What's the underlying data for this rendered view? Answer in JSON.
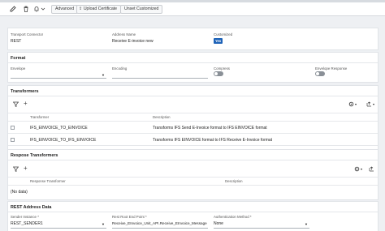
{
  "toolbar": {
    "advanced_label": "Advanced",
    "upload_label": "Upload Certificate",
    "unset_label": "Unset Customized"
  },
  "header": {
    "transport_connector_label": "Transport Connector",
    "transport_connector_value": "REST",
    "address_name_label": "Address Name",
    "address_name_value": "Receive E-invoice new",
    "customized_label": "Customized",
    "customized_value": "Yes"
  },
  "format": {
    "title": "Format",
    "envelope_label": "Envelope",
    "encoding_label": "Encoding",
    "compress_label": "Compress",
    "envelope_response_label": "Envelope Response"
  },
  "transformers": {
    "title": "Transformers",
    "col_transformer": "Transformer",
    "col_description": "Description",
    "rows": [
      {
        "transformer": "IFS_EINVOICE_TO_EINVOICE",
        "description": "Transforms IFS Send E-Invoice format to IFS EINVOICE format"
      },
      {
        "transformer": "IFS_EINVOICE_TO_IFS_EINVOICE",
        "description": "Transforms IFS EINVOICE format to IFS Receive E-Invoice format"
      }
    ]
  },
  "response_transformers": {
    "title": "Respose Transformers",
    "col_transformer": "Response Transformer",
    "col_description": "Description",
    "empty_text": "(No data)"
  },
  "rest_address": {
    "title": "REST Address Data",
    "sender_instance_label": "Sender Instance *",
    "sender_instance_value": "REST_SENDER1",
    "root_endpoint_label": "Rest Root End Point *",
    "root_endpoint_value": "Receive_EInvoice_Unit_API.Receive_EInvoice_Message",
    "auth_method_label": "Authentication Method *",
    "auth_method_value": "None"
  },
  "colors": {
    "accent": "#1e63b8",
    "toggle_off": "#8a9097"
  }
}
